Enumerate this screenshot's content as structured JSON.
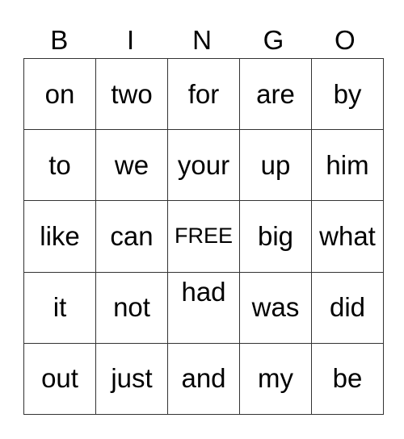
{
  "header": [
    "B",
    "I",
    "N",
    "G",
    "O"
  ],
  "rows": [
    [
      "on",
      "two",
      "for",
      "are",
      "by"
    ],
    [
      "to",
      "we",
      "your",
      "up",
      "him"
    ],
    [
      "like",
      "can",
      "FREE",
      "big",
      "what"
    ],
    [
      "it",
      "not",
      "had",
      "was",
      "did"
    ],
    [
      "out",
      "just",
      "and",
      "my",
      "be"
    ]
  ],
  "free_cell": {
    "row": 2,
    "col": 2
  }
}
